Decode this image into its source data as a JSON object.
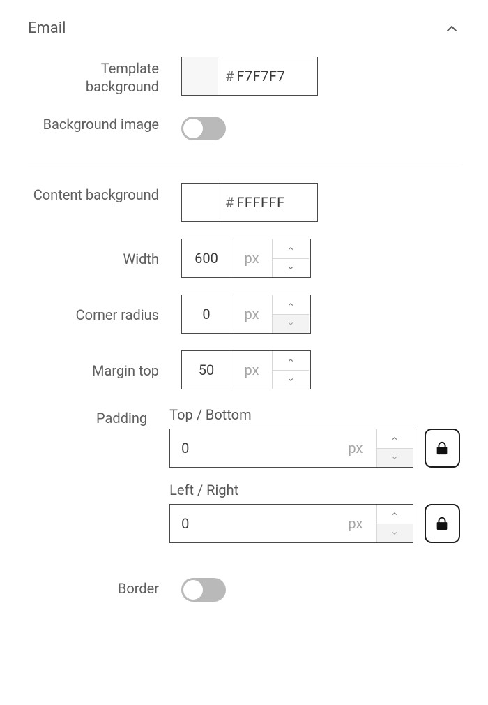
{
  "section": {
    "title": "Email"
  },
  "templateBackground": {
    "label": "Template background",
    "hash": "#",
    "hex": "F7F7F7",
    "swatch": "#F7F7F7"
  },
  "backgroundImage": {
    "label": "Background image",
    "enabled": false
  },
  "contentBackground": {
    "label": "Content background",
    "hash": "#",
    "hex": "FFFFFF",
    "swatch": "#FFFFFF"
  },
  "width": {
    "label": "Width",
    "value": "600",
    "unit": "px"
  },
  "cornerRadius": {
    "label": "Corner radius",
    "value": "0",
    "unit": "px"
  },
  "marginTop": {
    "label": "Margin top",
    "value": "50",
    "unit": "px"
  },
  "padding": {
    "label": "Padding",
    "topBottom": {
      "label": "Top / Bottom",
      "value": "0",
      "unit": "px"
    },
    "leftRight": {
      "label": "Left / Right",
      "value": "0",
      "unit": "px"
    }
  },
  "border": {
    "label": "Border",
    "enabled": false
  }
}
